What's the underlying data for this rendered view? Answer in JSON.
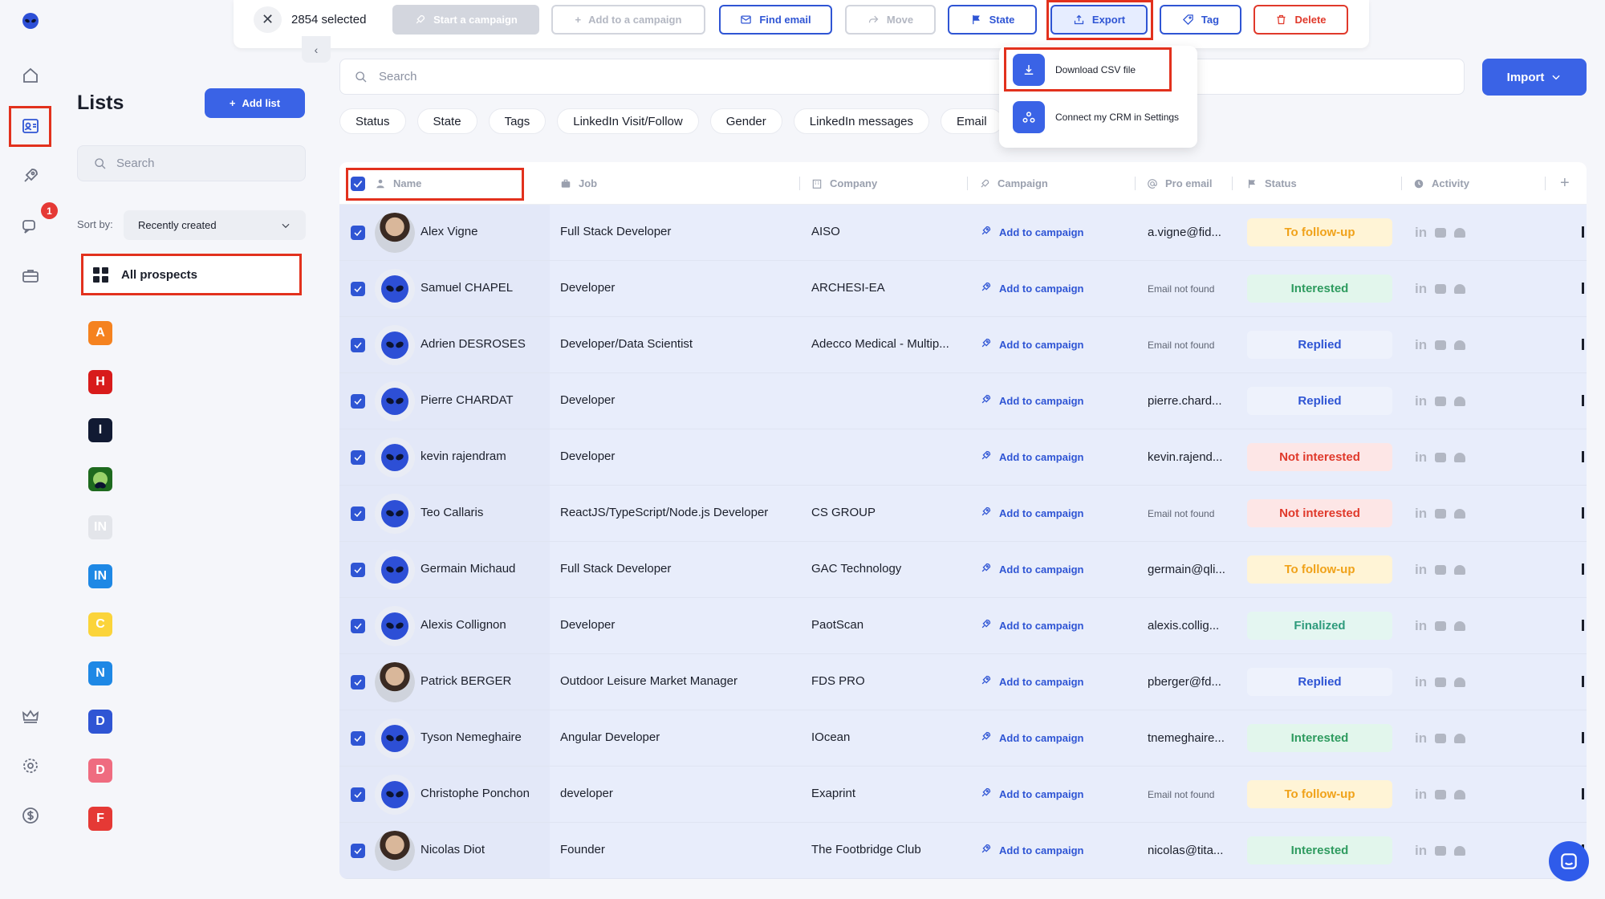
{
  "toolbar": {
    "selected_text": "2854 selected",
    "start_campaign": "Start a campaign",
    "add_to_campaign": "Add to a campaign",
    "find_email": "Find email",
    "move": "Move",
    "state": "State",
    "export": "Export",
    "tag": "Tag",
    "delete": "Delete"
  },
  "export_menu": {
    "download_csv": "Download CSV file",
    "connect_crm": "Connect my CRM in Settings"
  },
  "sidebar_rail": {
    "notification_count": "1",
    "icons": [
      "home-icon",
      "contacts-icon",
      "rocket-icon",
      "chat-icon",
      "briefcase-icon",
      "crown-icon",
      "gear-icon",
      "dollar-icon"
    ]
  },
  "lists_panel": {
    "title": "Lists",
    "add_list": "Add list",
    "search_placeholder": "Search",
    "sort_label": "Sort by:",
    "sort_value": "Recently created",
    "all_prospects": "All prospects",
    "tiles": [
      {
        "letter": "A",
        "color": "#f5821f"
      },
      {
        "letter": "H",
        "color": "#d81b1b"
      },
      {
        "letter": "I",
        "color": "#111a33"
      },
      {
        "letter": "",
        "color": "#1e6a1e",
        "icon": "alien-icon"
      },
      {
        "letter": "IN",
        "color": "#e3e5ea"
      },
      {
        "letter": "IN",
        "color": "#1e88e5"
      },
      {
        "letter": "C",
        "color": "#fbd43a"
      },
      {
        "letter": "N",
        "color": "#1e88e5"
      },
      {
        "letter": "D",
        "color": "#2f55d4"
      },
      {
        "letter": "D",
        "color": "#ef6c80"
      },
      {
        "letter": "F",
        "color": "#e53935"
      }
    ]
  },
  "main": {
    "search_placeholder": "Search",
    "import_label": "Import",
    "filters": [
      "Status",
      "State",
      "Tags",
      "LinkedIn Visit/Follow",
      "Gender",
      "LinkedIn messages",
      "Email"
    ]
  },
  "table": {
    "columns": {
      "name": "Name",
      "job": "Job",
      "company": "Company",
      "campaign": "Campaign",
      "pro_email": "Pro email",
      "status": "Status",
      "activity": "Activity"
    },
    "add_to_campaign_label": "Add to campaign",
    "rows": [
      {
        "name": "Alex Vigne",
        "job": "Full Stack Developer",
        "company": "AISO",
        "email": "a.vigne@fid...",
        "status": "To follow-up",
        "avatar": "photo"
      },
      {
        "name": "Samuel CHAPEL",
        "job": "Developer",
        "company": "ARCHESI-EA",
        "email": "Email not found",
        "status": "Interested",
        "avatar": "alien"
      },
      {
        "name": "Adrien DESROSES",
        "job": "Developer/Data Scientist",
        "company": "Adecco Medical - Multip...",
        "email": "Email not found",
        "status": "Replied",
        "avatar": "alien"
      },
      {
        "name": "Pierre CHARDAT",
        "job": "Developer",
        "company": "",
        "email": "pierre.chard...",
        "status": "Replied",
        "avatar": "alien"
      },
      {
        "name": "kevin rajendram",
        "job": "Developer",
        "company": "",
        "email": "kevin.rajend...",
        "status": "Not interested",
        "avatar": "alien"
      },
      {
        "name": "Teo Callaris",
        "job": "ReactJS/TypeScript/Node.js Developer",
        "company": "CS GROUP",
        "email": "Email not found",
        "status": "Not interested",
        "avatar": "alien"
      },
      {
        "name": "Germain Michaud",
        "job": "Full Stack Developer",
        "company": "GAC Technology",
        "email": "germain@qli...",
        "status": "To follow-up",
        "avatar": "alien"
      },
      {
        "name": "Alexis Collignon",
        "job": "Developer",
        "company": "PaotScan",
        "email": "alexis.collig...",
        "status": "Finalized",
        "avatar": "alien"
      },
      {
        "name": "Patrick BERGER",
        "job": "Outdoor Leisure Market Manager",
        "company": "FDS PRO",
        "email": "pberger@fd...",
        "status": "Replied",
        "avatar": "photo"
      },
      {
        "name": "Tyson Nemeghaire",
        "job": "Angular Developer",
        "company": "IOcean",
        "email": "tnemeghaire...",
        "status": "Interested",
        "avatar": "alien"
      },
      {
        "name": "Christophe Ponchon",
        "job": "developer",
        "company": "Exaprint",
        "email": "Email not found",
        "status": "To follow-up",
        "avatar": "alien"
      },
      {
        "name": "Nicolas Diot",
        "job": "Founder",
        "company": "The Footbridge Club",
        "email": "nicolas@tita...",
        "status": "Interested",
        "avatar": "photo"
      }
    ]
  },
  "status_colors": {
    "To follow-up": {
      "bg": "#fff4d6",
      "fg": "#f0a21a"
    },
    "Interested": {
      "bg": "#e2f6ec",
      "fg": "#2e9b5f"
    },
    "Replied": {
      "bg": "#eef2fc",
      "fg": "#2f55d4"
    },
    "Not interested": {
      "bg": "#fde6e6",
      "fg": "#e0392b"
    },
    "Finalized": {
      "bg": "#e4f6f1",
      "fg": "#2e9b7c"
    }
  }
}
